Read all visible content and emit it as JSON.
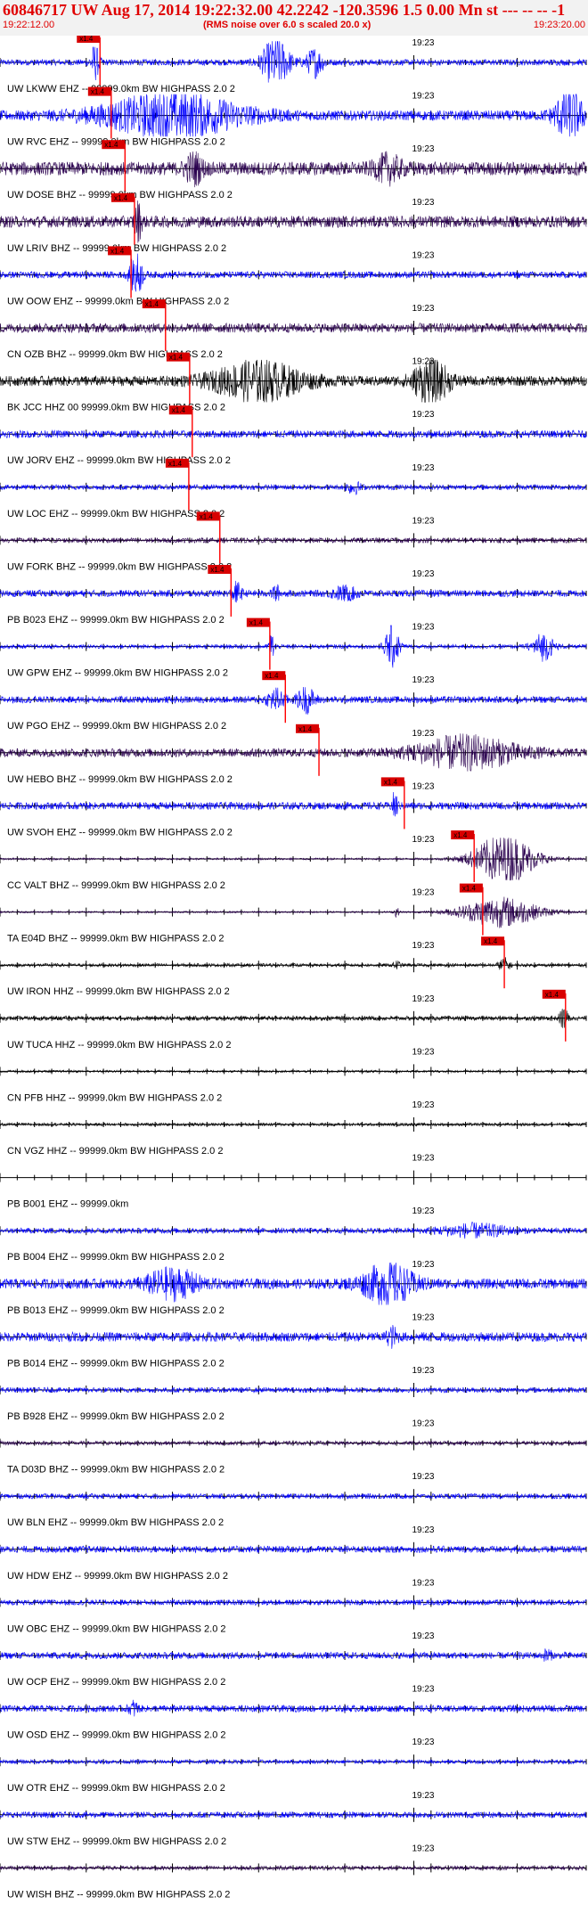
{
  "header": {
    "title": "60846717 UW Aug 17, 2014 19:22:32.00   42.2242 -120.3596  1.5 0.00 Mn st --- -- --   -1",
    "start_time": "19:22:12.00",
    "subtitle": "(RMS noise over 6.0 s scaled 20.0 x)",
    "end_time": "19:23:20.00"
  },
  "chart_data": {
    "type": "line",
    "title": "60846717 UW Aug 17, 2014 19:22:32.00   42.2242 -120.3596  1.5 0.00 Mn st --- -- --   -1",
    "x_start": "19:22:12.00",
    "x_end": "19:23:20.00",
    "x_range_s": [
      0,
      68
    ],
    "tick_interval_s": 2,
    "minute_mark": {
      "label": "19:23",
      "t_s": 48
    },
    "grid": false,
    "pick_label": "x1.4",
    "colors": {
      "blue": "#0000ff",
      "purple": "#2a004f",
      "black": "#000000",
      "pick": "#ff0000",
      "pick_box": "#d80000"
    },
    "traces": [
      {
        "label": "UW LKWW EHZ -- 99999.0km BW  HIGHPASS  2.0  2",
        "color": "blue",
        "pick_s": 11.6,
        "noise": 0.18,
        "bursts": [
          {
            "t": 11.0,
            "w": 0.5,
            "a": 1.0
          },
          {
            "t": 32.0,
            "w": 1.6,
            "a": 1.4
          },
          {
            "t": 36.5,
            "w": 1.0,
            "a": 0.8
          }
        ]
      },
      {
        "label": "UW RVC EHZ -- 99999.0km BW  HIGHPASS  2.0  2",
        "color": "blue",
        "pick_s": 12.9,
        "noise": 0.3,
        "bursts": [
          {
            "t": 20.0,
            "w": 8.0,
            "a": 1.2
          },
          {
            "t": 66.0,
            "w": 1.6,
            "a": 1.4
          }
        ]
      },
      {
        "label": "UW DOSE BHZ -- 99999.0km BW  HIGHPASS  2.0  2",
        "color": "purple",
        "pick_s": 14.5,
        "noise": 0.4,
        "bursts": [
          {
            "t": 22.5,
            "w": 1.0,
            "a": 0.8
          },
          {
            "t": 45.0,
            "w": 1.5,
            "a": 0.7
          }
        ]
      },
      {
        "label": "UW LRIV BHZ -- 99999.0km BW  HIGHPASS  2.0  2",
        "color": "purple",
        "pick_s": 15.6,
        "noise": 0.35,
        "bursts": [
          {
            "t": 16.0,
            "w": 0.4,
            "a": 1.1
          }
        ]
      },
      {
        "label": "UW OOW EHZ -- 99999.0km BW  HIGHPASS  2.0  2",
        "color": "blue",
        "pick_s": 15.2,
        "noise": 0.2,
        "bursts": [
          {
            "t": 15.8,
            "w": 0.7,
            "a": 1.3
          }
        ]
      },
      {
        "label": "CN OZB BHZ -- 99999.0km BW  HIGHPASS  2.0  2",
        "color": "purple",
        "pick_s": 19.2,
        "noise": 0.28,
        "bursts": []
      },
      {
        "label": "BK JCC HHZ 00 99999.0km BW  HIGHPASS  2.0  2",
        "color": "black",
        "pick_s": 22.0,
        "noise": 0.3,
        "bursts": [
          {
            "t": 30.0,
            "w": 5.0,
            "a": 1.1
          },
          {
            "t": 50.0,
            "w": 2.0,
            "a": 1.3
          }
        ]
      },
      {
        "label": "UW JORV EHZ -- 99999.0km BW  HIGHPASS  2.0  2",
        "color": "blue",
        "pick_s": 22.3,
        "noise": 0.22,
        "bursts": []
      },
      {
        "label": "UW LOC EHZ -- 99999.0km BW  HIGHPASS  2.0  2",
        "color": "blue",
        "pick_s": 21.9,
        "noise": 0.15,
        "bursts": [
          {
            "t": 41.0,
            "w": 0.8,
            "a": 0.35
          }
        ]
      },
      {
        "label": "UW FORK BHZ -- 99999.0km BW  HIGHPASS  2.0  2",
        "color": "purple",
        "pick_s": 25.5,
        "noise": 0.15,
        "bursts": []
      },
      {
        "label": "PB B023 EHZ -- 99999.0km BW  HIGHPASS  2.0  2",
        "color": "blue",
        "pick_s": 26.8,
        "noise": 0.2,
        "bursts": [
          {
            "t": 27.5,
            "w": 0.5,
            "a": 0.6
          },
          {
            "t": 32.0,
            "w": 0.4,
            "a": 0.5
          },
          {
            "t": 40.0,
            "w": 1.5,
            "a": 0.35
          }
        ]
      },
      {
        "label": "UW GPW EHZ -- 99999.0km BW  HIGHPASS  2.0  2",
        "color": "blue",
        "pick_s": 31.3,
        "noise": 0.12,
        "bursts": [
          {
            "t": 31.5,
            "w": 0.3,
            "a": 0.8
          },
          {
            "t": 45.5,
            "w": 0.8,
            "a": 1.3
          },
          {
            "t": 63.0,
            "w": 1.2,
            "a": 0.8
          }
        ]
      },
      {
        "label": "UW PGO EHZ -- 99999.0km BW  HIGHPASS  2.0  2",
        "color": "blue",
        "pick_s": 33.1,
        "noise": 0.2,
        "bursts": [
          {
            "t": 32.0,
            "w": 1.0,
            "a": 0.6
          },
          {
            "t": 35.5,
            "w": 1.0,
            "a": 0.7
          }
        ]
      },
      {
        "label": "UW HEBO BHZ -- 99999.0km BW  HIGHPASS  2.0  2",
        "color": "purple",
        "pick_s": 37.0,
        "noise": 0.25,
        "bursts": [
          {
            "t": 54.0,
            "w": 6.0,
            "a": 0.9
          }
        ]
      },
      {
        "label": "UW SVOH EHZ -- 99999.0km BW  HIGHPASS  2.0  2",
        "color": "blue",
        "pick_s": 46.9,
        "noise": 0.22,
        "bursts": [
          {
            "t": 45.8,
            "w": 0.3,
            "a": 0.9
          }
        ]
      },
      {
        "label": "CC VALT BHZ -- 99999.0km BW  HIGHPASS  2.0  2",
        "color": "purple",
        "pick_s": 55.0,
        "noise": 0.06,
        "bursts": [
          {
            "t": 58.5,
            "w": 3.5,
            "a": 1.5
          }
        ]
      },
      {
        "label": "TA E04D BHZ -- 99999.0km BW  HIGHPASS  2.0  2",
        "color": "purple",
        "pick_s": 56.0,
        "noise": 0.05,
        "bursts": [
          {
            "t": 58.0,
            "w": 4.5,
            "a": 0.9
          },
          {
            "t": 46.0,
            "w": 0.3,
            "a": 0.3
          }
        ]
      },
      {
        "label": "UW IRON HHZ -- 99999.0km BW  HIGHPASS  2.0  2",
        "color": "black",
        "pick_s": 58.5,
        "noise": 0.1,
        "bursts": [
          {
            "t": 58.5,
            "w": 0.6,
            "a": 0.4
          },
          {
            "t": 46.0,
            "w": 0.4,
            "a": 0.25
          }
        ]
      },
      {
        "label": "UW TUCA HHZ -- 99999.0km BW  HIGHPASS  2.0  2",
        "color": "black",
        "pick_s": 65.6,
        "noise": 0.13,
        "bursts": [
          {
            "t": 65.4,
            "w": 0.5,
            "a": 0.6
          }
        ]
      },
      {
        "label": "CN PFB HHZ -- 99999.0km BW  HIGHPASS  2.0  2",
        "color": "black",
        "pick_s": null,
        "noise": 0.07,
        "bursts": []
      },
      {
        "label": "CN VGZ HHZ -- 99999.0km BW  HIGHPASS  2.0  2",
        "color": "black",
        "pick_s": null,
        "noise": 0.09,
        "bursts": []
      },
      {
        "label": "PB B001 EHZ -- 99999.0km",
        "color": "blue",
        "pick_s": null,
        "noise": 0,
        "bursts": []
      },
      {
        "label": "PB B004 EHZ -- 99999.0km BW  HIGHPASS  2.0  2",
        "color": "blue",
        "pick_s": null,
        "noise": 0.16,
        "bursts": [
          {
            "t": 55.0,
            "w": 4.0,
            "a": 0.35
          }
        ]
      },
      {
        "label": "PB B013 EHZ -- 99999.0km BW  HIGHPASS  2.0  2",
        "color": "blue",
        "pick_s": null,
        "noise": 0.3,
        "bursts": [
          {
            "t": 20.0,
            "w": 3.0,
            "a": 0.8
          },
          {
            "t": 45.0,
            "w": 3.0,
            "a": 1.1
          }
        ]
      },
      {
        "label": "PB B014 EHZ -- 99999.0km BW  HIGHPASS  2.0  2",
        "color": "blue",
        "pick_s": null,
        "noise": 0.28,
        "bursts": [
          {
            "t": 45.5,
            "w": 0.6,
            "a": 0.5
          }
        ]
      },
      {
        "label": "PB B928 EHZ -- 99999.0km BW  HIGHPASS  2.0  2",
        "color": "blue",
        "pick_s": null,
        "noise": 0.15,
        "bursts": []
      },
      {
        "label": "TA D03D BHZ -- 99999.0km BW  HIGHPASS  2.0  2",
        "color": "purple",
        "pick_s": null,
        "noise": 0.12,
        "bursts": []
      },
      {
        "label": "UW BLN EHZ -- 99999.0km BW  HIGHPASS  2.0  2",
        "color": "blue",
        "pick_s": null,
        "noise": 0.15,
        "bursts": []
      },
      {
        "label": "UW HDW EHZ -- 99999.0km BW  HIGHPASS  2.0  2",
        "color": "blue",
        "pick_s": null,
        "noise": 0.2,
        "bursts": []
      },
      {
        "label": "UW OBC EHZ -- 99999.0km BW  HIGHPASS  2.0  2",
        "color": "blue",
        "pick_s": null,
        "noise": 0.16,
        "bursts": []
      },
      {
        "label": "UW OCP EHZ -- 99999.0km BW  HIGHPASS  2.0  2",
        "color": "blue",
        "pick_s": null,
        "noise": 0.2,
        "bursts": [
          {
            "t": 63.5,
            "w": 0.4,
            "a": 0.4
          }
        ]
      },
      {
        "label": "UW OSD EHZ -- 99999.0km BW  HIGHPASS  2.0  2",
        "color": "blue",
        "pick_s": null,
        "noise": 0.2,
        "bursts": [
          {
            "t": 15.5,
            "w": 0.5,
            "a": 0.4
          }
        ]
      },
      {
        "label": "UW OTR EHZ -- 99999.0km BW  HIGHPASS  2.0  2",
        "color": "blue",
        "pick_s": null,
        "noise": 0.12,
        "bursts": []
      },
      {
        "label": "UW STW EHZ -- 99999.0km BW  HIGHPASS  2.0  2",
        "color": "blue",
        "pick_s": null,
        "noise": 0.18,
        "bursts": []
      },
      {
        "label": "UW WISH BHZ -- 99999.0km BW  HIGHPASS  2.0  2",
        "color": "purple",
        "pick_s": null,
        "noise": 0.12,
        "bursts": []
      }
    ]
  }
}
